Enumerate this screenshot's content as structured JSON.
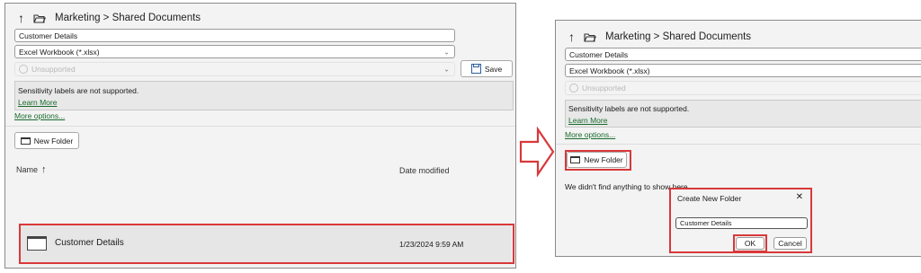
{
  "left": {
    "breadcrumb": "Marketing > Shared Documents",
    "file_name": "Customer Details",
    "file_type": "Excel Workbook (*.xlsx)",
    "sensitivity": "Unsupported",
    "save_label": "Save",
    "notice_text": "Sensitivity labels are not supported.",
    "learn_more": "Learn More",
    "more_options": "More options...",
    "new_folder": "New Folder",
    "col_name": "Name",
    "col_date": "Date modified",
    "row": {
      "name": "Customer Details",
      "date": "1/23/2024 9:59 AM"
    }
  },
  "right": {
    "breadcrumb": "Marketing > Shared Documents",
    "file_name": "Customer Details",
    "file_type": "Excel Workbook (*.xlsx)",
    "sensitivity": "Unsupported",
    "notice_text": "Sensitivity labels are not supported.",
    "learn_more": "Learn More",
    "more_options": "More options...",
    "new_folder": "New Folder",
    "empty_msg": "We didn't find anything to show here.",
    "dialog": {
      "title": "Create New Folder",
      "close": "✕",
      "input_value": "Customer Details",
      "ok": "OK",
      "cancel": "Cancel"
    }
  },
  "icons": {
    "up_arrow": "↑",
    "sort_arrow": "↑",
    "chevron": "⌄"
  },
  "colors": {
    "highlight": "#d9383a",
    "link": "#1a6b2e"
  }
}
